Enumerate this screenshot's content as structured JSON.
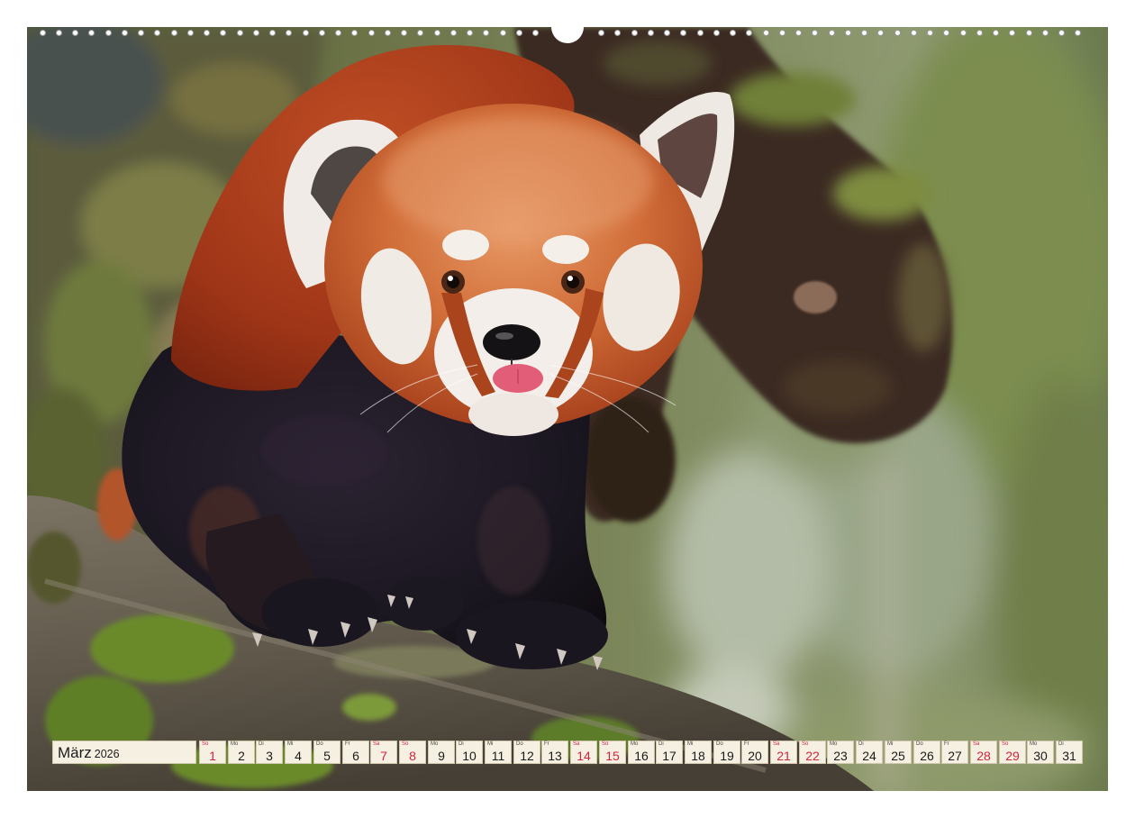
{
  "calendar": {
    "month": "März",
    "year": "2026",
    "days": [
      {
        "n": "1",
        "wd": "So",
        "weekend": true
      },
      {
        "n": "2",
        "wd": "Mo",
        "weekend": false
      },
      {
        "n": "3",
        "wd": "Di",
        "weekend": false
      },
      {
        "n": "4",
        "wd": "Mi",
        "weekend": false
      },
      {
        "n": "5",
        "wd": "Do",
        "weekend": false
      },
      {
        "n": "6",
        "wd": "Fr",
        "weekend": false
      },
      {
        "n": "7",
        "wd": "Sa",
        "weekend": true
      },
      {
        "n": "8",
        "wd": "So",
        "weekend": true
      },
      {
        "n": "9",
        "wd": "Mo",
        "weekend": false
      },
      {
        "n": "10",
        "wd": "Di",
        "weekend": false
      },
      {
        "n": "11",
        "wd": "Mi",
        "weekend": false
      },
      {
        "n": "12",
        "wd": "Do",
        "weekend": false
      },
      {
        "n": "13",
        "wd": "Fr",
        "weekend": false
      },
      {
        "n": "14",
        "wd": "Sa",
        "weekend": true
      },
      {
        "n": "15",
        "wd": "So",
        "weekend": true
      },
      {
        "n": "16",
        "wd": "Mo",
        "weekend": false
      },
      {
        "n": "17",
        "wd": "Di",
        "weekend": false
      },
      {
        "n": "18",
        "wd": "Mi",
        "weekend": false
      },
      {
        "n": "19",
        "wd": "Do",
        "weekend": false
      },
      {
        "n": "20",
        "wd": "Fr",
        "weekend": false
      },
      {
        "n": "21",
        "wd": "Sa",
        "weekend": true
      },
      {
        "n": "22",
        "wd": "So",
        "weekend": true
      },
      {
        "n": "23",
        "wd": "Mo",
        "weekend": false
      },
      {
        "n": "24",
        "wd": "Di",
        "weekend": false
      },
      {
        "n": "25",
        "wd": "Mi",
        "weekend": false
      },
      {
        "n": "26",
        "wd": "Do",
        "weekend": false
      },
      {
        "n": "27",
        "wd": "Fr",
        "weekend": false
      },
      {
        "n": "28",
        "wd": "Sa",
        "weekend": true
      },
      {
        "n": "29",
        "wd": "So",
        "weekend": true
      },
      {
        "n": "30",
        "wd": "Mo",
        "weekend": false
      },
      {
        "n": "31",
        "wd": "Di",
        "weekend": false
      }
    ]
  },
  "colors": {
    "weekend": "#d2233f",
    "strip_bg": "#f5f0e1",
    "text": "#1b1b1b"
  }
}
